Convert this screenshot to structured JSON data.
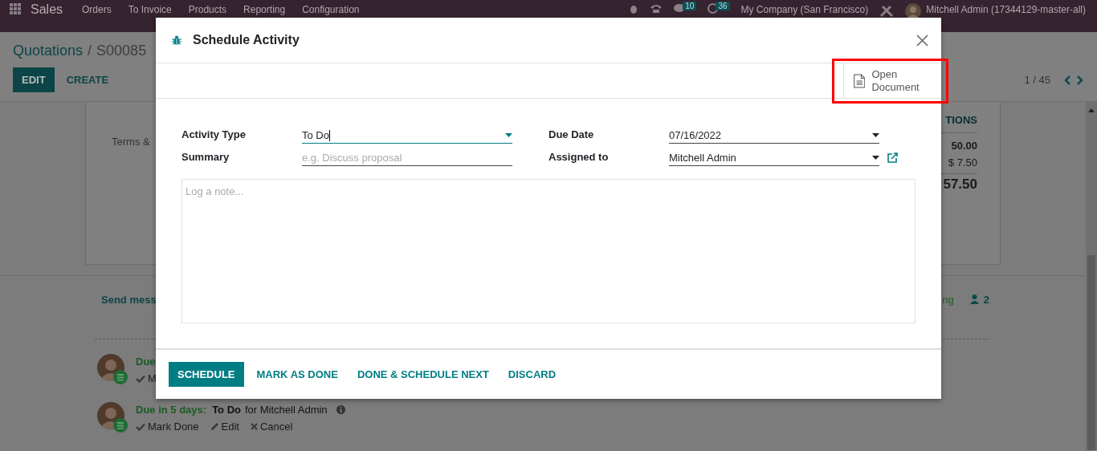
{
  "navbar": {
    "app": "Sales",
    "menu": [
      "Orders",
      "To Invoice",
      "Products",
      "Reporting",
      "Configuration"
    ],
    "messages_badge": "10",
    "activities_badge": "36",
    "company": "My Company (San Francisco)",
    "user": "Mitchell Admin (17344129-master-all)"
  },
  "breadcrumb": {
    "parent": "Quotations",
    "separator": "/",
    "current": "S00085"
  },
  "actions": [
    {
      "label": "EDIT",
      "kind": "primary"
    },
    {
      "label": "CREATE",
      "kind": "link"
    }
  ],
  "pager": "1 / 45",
  "sheet": {
    "terms": "Terms &",
    "totals_header": "TIONS",
    "untaxed": "50.00",
    "taxes": "$ 7.50",
    "total": "57.50"
  },
  "chatter": {
    "send_message": "Send mess",
    "following": "ng",
    "followers": "2",
    "activities": [
      {
        "due": "Due",
        "actions": [
          "M"
        ]
      },
      {
        "due": "Due in 5 days:",
        "type": "To Do",
        "assignee": "for Mitchell Admin",
        "actions": [
          "Mark Done",
          "Edit",
          "Cancel"
        ]
      }
    ]
  },
  "dialog": {
    "title": "Schedule Activity",
    "open_document": "Open Document",
    "open_document_highlighted": true,
    "fields": [
      {
        "label": "Activity Type",
        "value": "To Do",
        "kind": "select",
        "focused": true
      },
      {
        "label": "Due Date",
        "value": "07/16/2022",
        "kind": "select",
        "focused": false
      },
      {
        "label": "Summary",
        "placeholder": "e.g. Discuss proposal",
        "kind": "text",
        "focused": false
      },
      {
        "label": "Assigned to",
        "value": "Mitchell Admin",
        "kind": "select-link",
        "focused": false
      }
    ],
    "note_placeholder": "Log a note...",
    "buttons": [
      {
        "label": "SCHEDULE",
        "primary": true
      },
      {
        "label": "MARK AS DONE",
        "primary": false
      },
      {
        "label": "DONE & SCHEDULE NEXT",
        "primary": false
      },
      {
        "label": "DISCARD",
        "primary": false
      }
    ]
  }
}
